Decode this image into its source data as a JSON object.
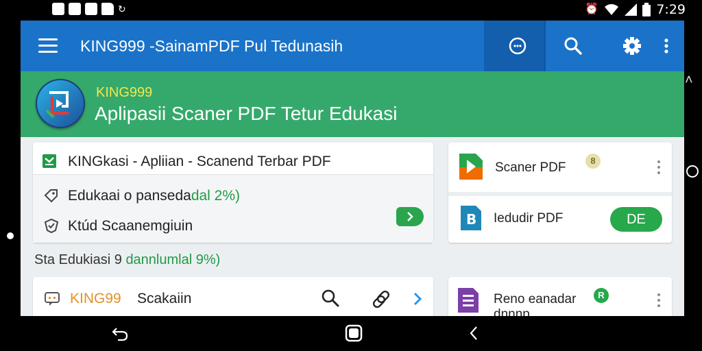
{
  "status_bar": {
    "time": "7:29",
    "left_icons": [
      "photo-icon",
      "screenshot-icon",
      "sim-icon",
      "folder-icon",
      "sync-icon"
    ],
    "right_icons": [
      "alarm-icon",
      "wifi-icon",
      "signal-icon",
      "battery-icon"
    ]
  },
  "toolbar": {
    "title": "KING999 -SainamPDF Pul Tedunasih",
    "icons": [
      "history-icon",
      "search-icon",
      "settings-icon",
      "more-vert-icon"
    ]
  },
  "header": {
    "brand": "KING999",
    "subtitle": "Aplipasii Scaner PDF Tetur Edukasi"
  },
  "left_card": {
    "items": [
      {
        "icon": "check-box-icon",
        "text": "KINGkasi - Apliian - Scanend Terbar PDF"
      },
      {
        "icon": "tag-icon",
        "text_main": "Edukaai o panseda",
        "text_green": "dal 2%)"
      },
      {
        "icon": "shield-check-icon",
        "text": "Ktúd Scaanemgiuin"
      }
    ],
    "action_icon": "arrow-right-icon"
  },
  "section": {
    "prefix": "Sta",
    "text_main": "Edukiasi 9 ",
    "text_green": "dannlumlal 9%)"
  },
  "bottom_card": {
    "brand": "KING99",
    "label": "Scakaiin",
    "icons": [
      "chat-icon",
      "search-icon",
      "link-icon",
      "chevron-right-icon"
    ]
  },
  "right_card": {
    "items": [
      {
        "icon": "pdf-play-icon",
        "label": "Scaner PDF",
        "badge": "8"
      },
      {
        "icon": "pdf-b-icon",
        "label": "Iedudir PDF",
        "button": "DE"
      }
    ]
  },
  "right_card_bottom": {
    "icon": "list-doc-icon",
    "label_line1": "Reno eanadar",
    "label_line2": "dnnnp",
    "badge": "R"
  },
  "colors": {
    "toolbar": "#1a73c9",
    "header": "#35a96b",
    "brand_yellow": "#f4e64a",
    "accent_green": "#27a84b",
    "brand_orange": "#e4912b"
  }
}
